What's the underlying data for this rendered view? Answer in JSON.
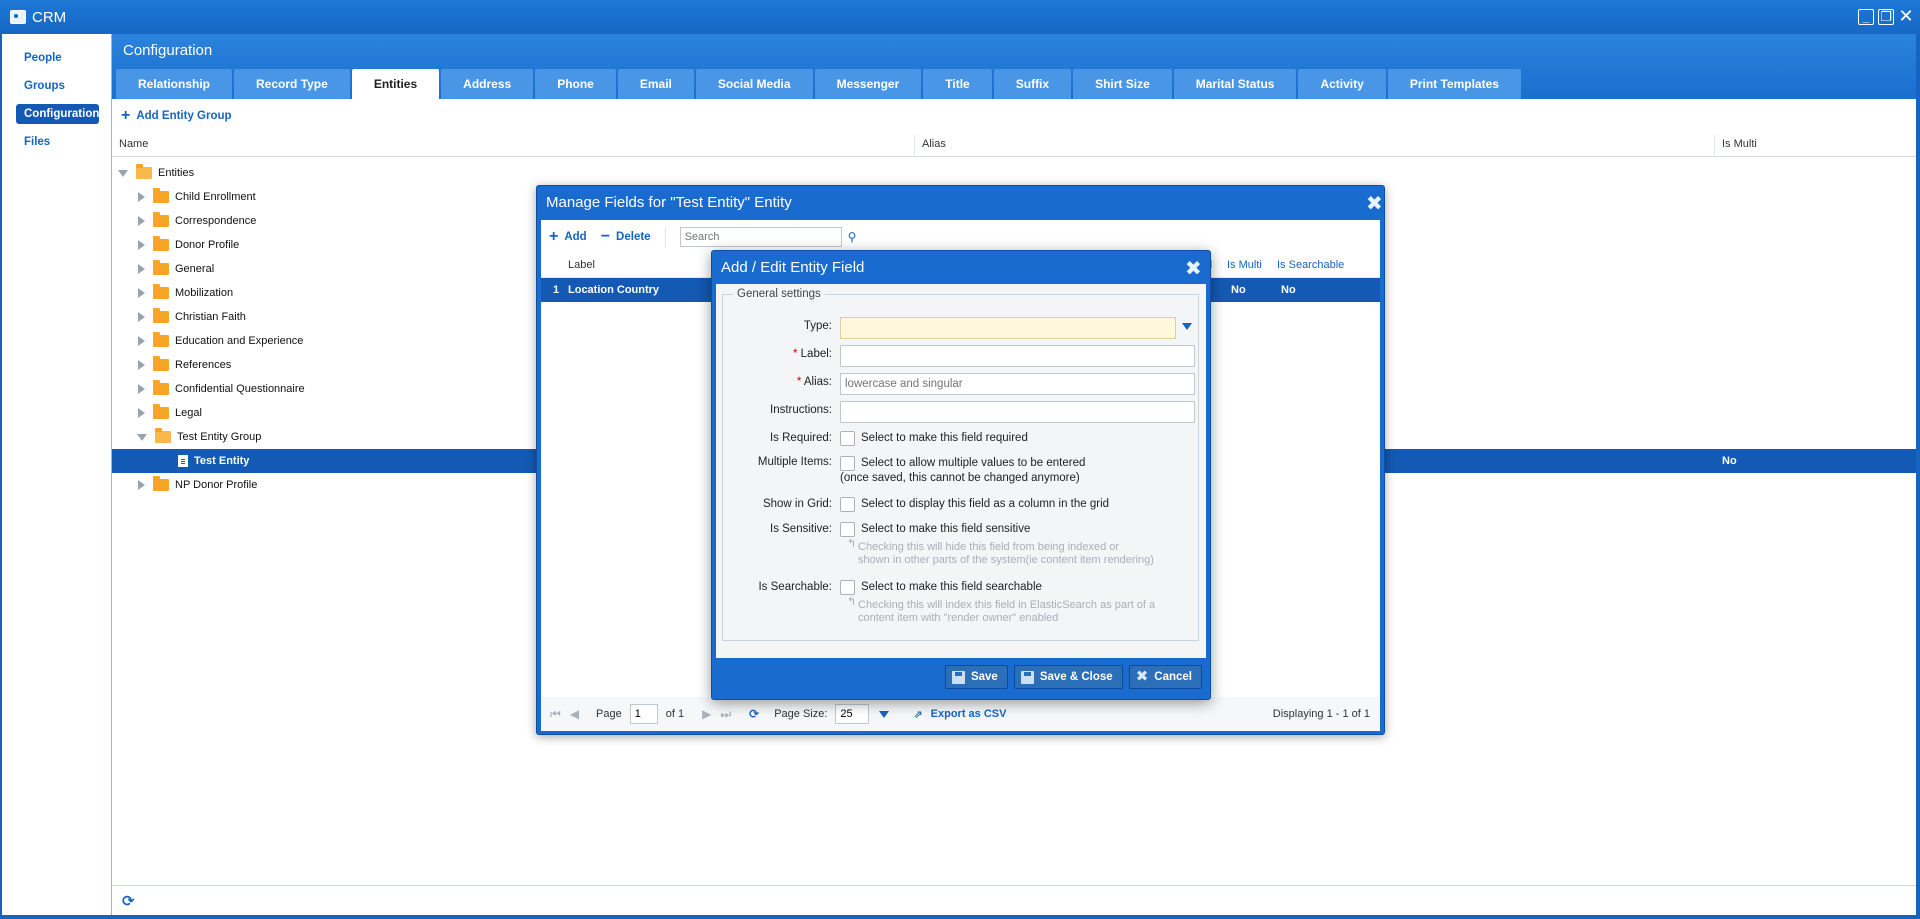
{
  "window": {
    "title": "CRM",
    "controls": [
      "minimize-icon",
      "restore-icon",
      "close-icon"
    ]
  },
  "nav": {
    "items": [
      {
        "label": "People",
        "active": false
      },
      {
        "label": "Groups",
        "active": false
      },
      {
        "label": "Configuration",
        "active": true
      },
      {
        "label": "Files",
        "active": false
      }
    ]
  },
  "main": {
    "title": "Configuration",
    "tabs": [
      "Relationship",
      "Record Type",
      "Entities",
      "Address",
      "Phone",
      "Email",
      "Social Media",
      "Messenger",
      "Title",
      "Suffix",
      "Shirt Size",
      "Marital Status",
      "Activity",
      "Print Templates"
    ],
    "active_tab": "Entities",
    "toolbar": {
      "add_group_label": "Add Entity Group"
    },
    "columns": {
      "name": "Name",
      "alias": "Alias",
      "is_multi": "Is Multi"
    },
    "tree": {
      "root": "Entities",
      "groups": [
        "Child Enrollment",
        "Correspondence",
        "Donor Profile",
        "General",
        "Mobilization",
        "Christian Faith",
        "Education and Experience",
        "References",
        "Confidential Questionnaire",
        "Legal",
        "Test Entity Group"
      ],
      "child": {
        "label": "Test Entity",
        "is_multi": "No"
      },
      "last": "NP Donor Profile"
    }
  },
  "manage_window": {
    "title": "Manage Fields for \"Test Entity\" Entity",
    "add_label": "Add",
    "delete_label": "Delete",
    "search_placeholder": "Search",
    "columns": {
      "label": "Label",
      "d": "d",
      "is_multi": "Is Multi",
      "is_searchable": "Is Searchable"
    },
    "row": {
      "num": "1",
      "label": "Location Country",
      "is_multi": "No",
      "is_searchable": "No"
    },
    "pager": {
      "page_label": "Page",
      "page_value": "1",
      "of_label": "of 1",
      "page_size_label": "Page Size:",
      "page_size_value": "25",
      "export_label": "Export as CSV",
      "displaying": "Displaying 1 - 1 of 1"
    }
  },
  "edit_window": {
    "title": "Add / Edit Entity Field",
    "legend": "General settings",
    "fields": {
      "type_label": "Type:",
      "label_label": "Label:",
      "alias_label": "Alias:",
      "alias_placeholder": "lowercase and singular",
      "instructions_label": "Instructions:",
      "required_label": "Is Required:",
      "required_text": "Select to make this field required",
      "multiple_label": "Multiple Items:",
      "multiple_text": "Select to allow multiple values to be entered",
      "multiple_note": "(once saved, this cannot be changed anymore)",
      "grid_label": "Show in Grid:",
      "grid_text": "Select to display this field as a column in the grid",
      "sensitive_label": "Is Sensitive:",
      "sensitive_text": "Select to make this field sensitive",
      "sensitive_hint_1": "Checking this will hide this field from being indexed or",
      "sensitive_hint_2": "shown in other parts of the system(ie content item rendering)",
      "searchable_label": "Is Searchable:",
      "searchable_text": "Select to make this field searchable",
      "searchable_hint_1": "Checking this will index this field in ElasticSearch as part of a",
      "searchable_hint_2": "content item with \"render owner\" enabled"
    },
    "buttons": {
      "save": "Save",
      "save_close": "Save & Close",
      "cancel": "Cancel"
    }
  }
}
